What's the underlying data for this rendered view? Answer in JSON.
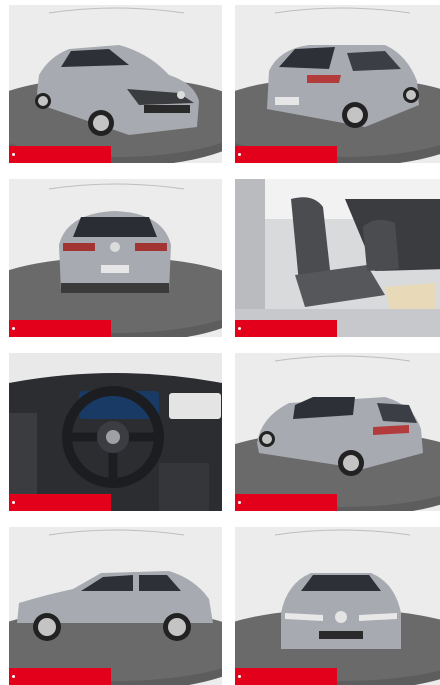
{
  "gallery": {
    "accent_color": "#e3001b",
    "car_color": "#a7aab0",
    "photos": [
      {
        "view": "front-left-exterior",
        "badge_label": ""
      },
      {
        "view": "rear-right-exterior",
        "badge_label": ""
      },
      {
        "view": "rear-exterior",
        "badge_label": ""
      },
      {
        "view": "front-seats-interior",
        "badge_label": ""
      },
      {
        "view": "dashboard-steering-wheel",
        "badge_label": ""
      },
      {
        "view": "rear-left-exterior",
        "badge_label": ""
      },
      {
        "view": "left-side-profile",
        "badge_label": ""
      },
      {
        "view": "front-exterior",
        "badge_label": ""
      }
    ]
  }
}
